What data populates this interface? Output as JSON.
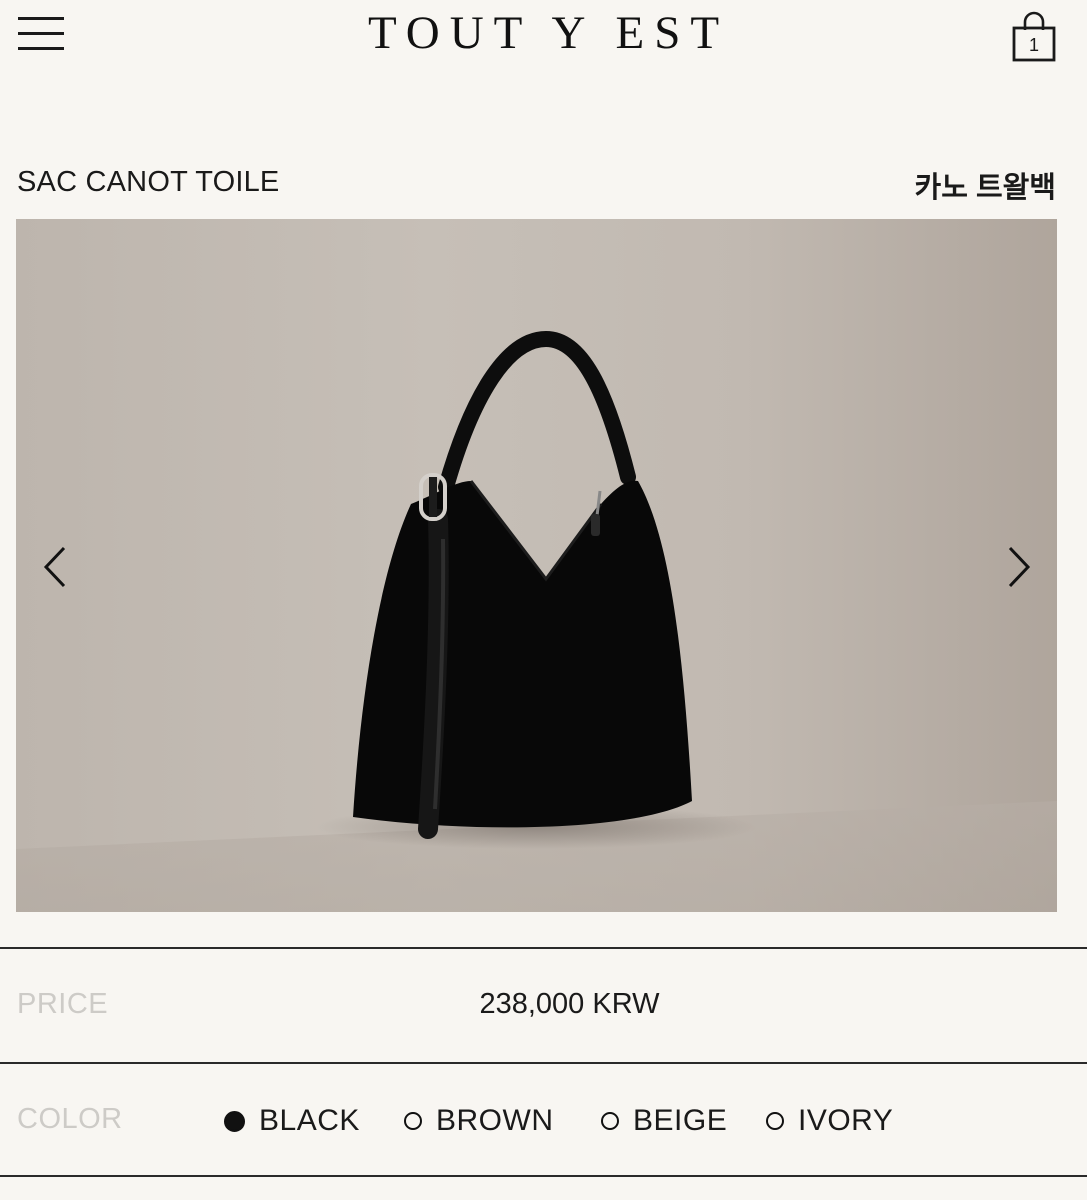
{
  "header": {
    "logo": "TOUT Y EST",
    "cart_count": "1"
  },
  "product": {
    "name": "SAC CANOT TOILE",
    "name_ko": "카노 트왈백"
  },
  "price": {
    "label": "PRICE",
    "value": "238,000 KRW"
  },
  "color": {
    "label": "COLOR",
    "options": [
      {
        "label": "BLACK",
        "selected": true
      },
      {
        "label": "BROWN",
        "selected": false
      },
      {
        "label": "BEIGE",
        "selected": false
      },
      {
        "label": "IVORY",
        "selected": false
      }
    ]
  }
}
